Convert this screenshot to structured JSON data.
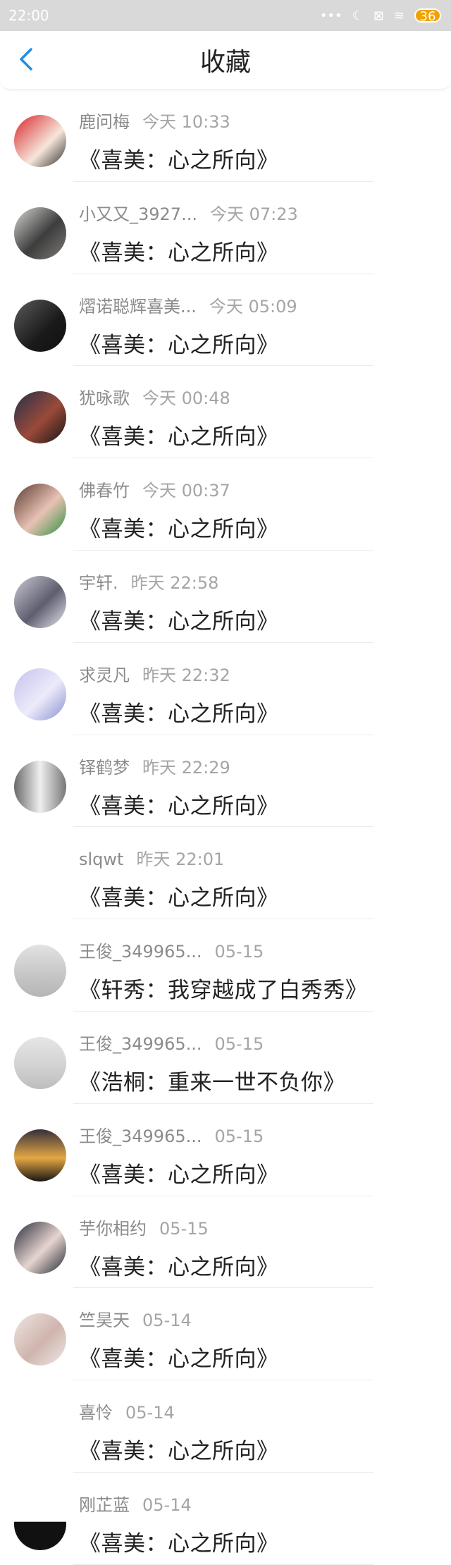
{
  "status_bar": {
    "time": "22:00",
    "battery": "36"
  },
  "header": {
    "title": "收藏"
  },
  "colors": {
    "accent": "#1e8ee6"
  },
  "items": [
    {
      "name": "鹿问梅",
      "time": "今天 10:33",
      "book": "《喜美：心之所向》",
      "avatar": "linear-gradient(135deg,#d8242a,#f7e6da 60%,#2d2d2d)"
    },
    {
      "name": "小又又_3927...",
      "time": "今天 07:23",
      "book": "《喜美：心之所向》",
      "avatar": "linear-gradient(135deg,#d6d6d2,#3d3d3d 55%,#7d7b78)"
    },
    {
      "name": "熠诺聪辉喜美...",
      "time": "今天 05:09",
      "book": "《喜美：心之所向》",
      "avatar": "linear-gradient(135deg,#5b5b5b,#1a1a1a 60%,#111)"
    },
    {
      "name": "犹咏歌",
      "time": "今天 00:48",
      "book": "《喜美：心之所向》",
      "avatar": "linear-gradient(135deg,#25304a,#9a4a3a 55%,#151515)"
    },
    {
      "name": "佛春竹",
      "time": "今天 00:37",
      "book": "《喜美：心之所向》",
      "avatar": "linear-gradient(135deg,#5b3b2f,#e8c2b5 55%,#2d8f3f)"
    },
    {
      "name": "宇轩.",
      "time": "昨天 22:58",
      "book": "《喜美：心之所向》",
      "avatar": "linear-gradient(135deg,#c9c9d4,#5e5e70 55%,#e8e8ef)"
    },
    {
      "name": "求灵凡",
      "time": "昨天 22:32",
      "book": "《喜美：心之所向》",
      "avatar": "linear-gradient(135deg,#c7c2ec,#ecebfa 55%,#8a8fd4)"
    },
    {
      "name": "铎鹤梦",
      "time": "昨天 22:29",
      "book": "《喜美：心之所向》",
      "avatar": "linear-gradient(90deg,#6a6a6a,#efefef 50%,#777)"
    },
    {
      "name": "slqwt",
      "time": "昨天 22:01",
      "book": "《喜美：心之所向》",
      "avatar": ""
    },
    {
      "name": "王俊_349965...",
      "time": "05-15",
      "book": "《轩秀：我穿越成了白秀秀》",
      "avatar": "linear-gradient(180deg,#e2e2e2,#c8c8c8 55%,#b5b5b5)"
    },
    {
      "name": "王俊_349965...",
      "time": "05-15",
      "book": "《浩桐：重来一世不负你》",
      "avatar": "linear-gradient(180deg,#e6e6e6,#d2d2d2 55%,#bdbdbd)"
    },
    {
      "name": "王俊_349965...",
      "time": "05-15",
      "book": "《喜美：心之所向》",
      "avatar": "linear-gradient(180deg,#34303a,#e5a844 55%,#1a1614)"
    },
    {
      "name": "芋你相约",
      "time": "05-15",
      "book": "《喜美：心之所向》",
      "avatar": "linear-gradient(135deg,#2a2b3a,#e6d5cf 55%,#1f2630)"
    },
    {
      "name": "竺昊天",
      "time": "05-14",
      "book": "《喜美：心之所向》",
      "avatar": "linear-gradient(135deg,#efe4e2,#cfb5ad 55%,#efe8e6)"
    },
    {
      "name": "喜怜",
      "time": "05-14",
      "book": "《喜美：心之所向》",
      "avatar": ""
    },
    {
      "name": "刚芷蓝",
      "time": "05-14",
      "book": "《喜美：心之所向》",
      "avatar": "linear-gradient(180deg,#ffffff 0,#ffffff 45%,#111 46%)"
    }
  ]
}
